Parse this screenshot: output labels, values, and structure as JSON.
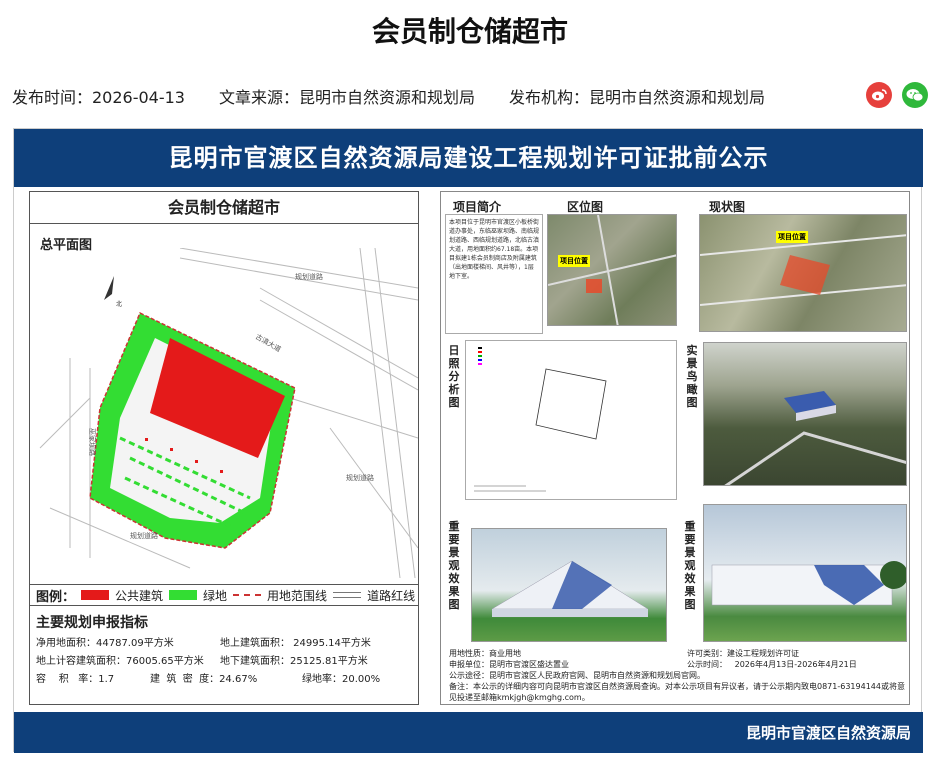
{
  "article": {
    "title": "会员制仓储超市",
    "publish_time": "发布时间：2026-04-13",
    "source": "文章来源：昆明市自然资源和规划局",
    "publisher": "发布机构：昆明市自然资源和规划局"
  },
  "share": {
    "weibo_icon": "weibo-icon",
    "wechat_icon": "wechat-icon"
  },
  "poster": {
    "banner_title": "昆明市官渡区自然资源局建设工程规划许可证批前公示",
    "footer_org": "昆明市官渡区自然资源局",
    "left": {
      "title": "会员制仓储超市",
      "site_plan_label": "总平面图",
      "legend_title": "图例：",
      "legend": [
        {
          "label": "公共建筑",
          "color": "#e41a1a"
        },
        {
          "label": "绿地",
          "color": "#33dd33"
        },
        {
          "label": "用地范围线",
          "color": "#cc3333"
        },
        {
          "label": "道路红线",
          "color": "#777777"
        }
      ],
      "indicators_title": "主要规划申报指标",
      "indicators": {
        "net_land": "净用地面积：44787.09平方米",
        "above_area": "地上建筑面积：   24995.14平方米",
        "far_area": "地上计容建筑面积：76005.65平方米",
        "below_area": "地下建筑面积：25125.81平方米",
        "far": "容    积   率：1.7",
        "density": "建  筑  密  度：24.67%",
        "green": "绿地率：20.00%"
      }
    },
    "right": {
      "intro_label": "项目简介",
      "intro_text": "本项目位于昆明市官渡区小板桥街道办事处，东临巫家坝路、南临规划道路、西临规划道路，北临古滇大道，用地面积约67.18亩。本项目拟建1栋会员制商店及附属建筑（出地面楼梯间、风井等），1层地下室。",
      "location_label": "区位图",
      "status_label": "现状图",
      "project_tag": "项目位置",
      "sun_label": "日照分析图",
      "aerial_label": "实景鸟瞰图",
      "render1_label": "重要景观效果图",
      "render2_label": "重要景观效果图",
      "info": {
        "land_use": "用地性质：商业用地",
        "license_type": "许可类别：建设工程规划许可证",
        "applicant": "申报单位：昆明市官渡区盛达置业",
        "period": "公示时间：   2026年4月13日-2026年4月21日",
        "channel": "公示途径：昆明市官渡区人民政府官网、昆明市自然资源和规划局官网。",
        "note": "备注：本公示的详细内容可向昆明市官渡区自然资源局查询。对本公示项目有异议者，请于公示期内致电0871-63194144或将意见投递至邮箱kmkjgh@kmghg.com。"
      }
    }
  }
}
